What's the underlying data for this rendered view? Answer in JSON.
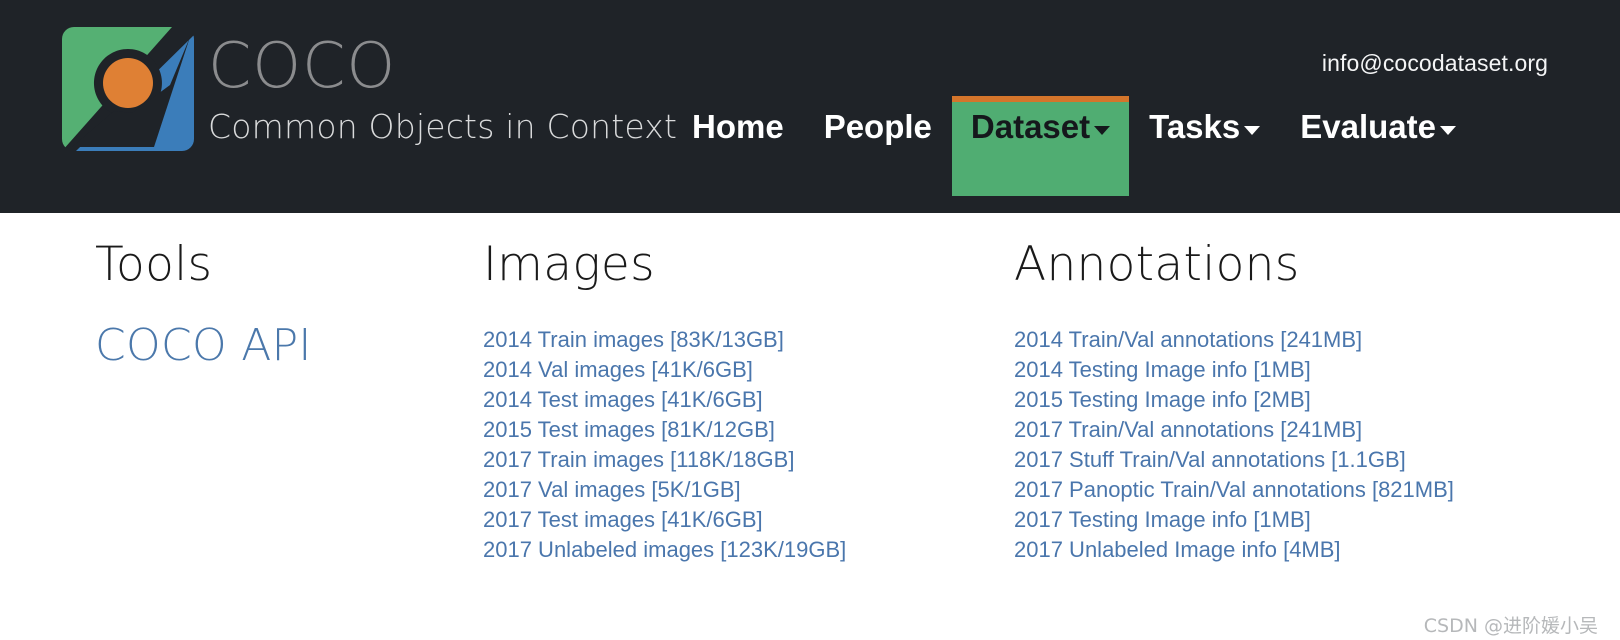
{
  "header": {
    "brand": {
      "title": "COCO",
      "subtitle": "Common Objects in Context",
      "logo_icon": "coco-logo-icon",
      "colors": {
        "green": "#55b073",
        "blue": "#3b7dba",
        "orange": "#df8034",
        "dark": "#1f2328"
      }
    },
    "contact_email": "info@cocodataset.org",
    "nav": [
      {
        "label": "Home",
        "has_caret": false,
        "active": false
      },
      {
        "label": "People",
        "has_caret": false,
        "active": false
      },
      {
        "label": "Dataset",
        "has_caret": true,
        "active": true
      },
      {
        "label": "Tasks",
        "has_caret": true,
        "active": false
      },
      {
        "label": "Evaluate",
        "has_caret": true,
        "active": false
      }
    ],
    "active_tab_bg": "#50ad72",
    "active_tab_border": "#d4752b",
    "background": "#1f2328"
  },
  "main": {
    "link_color": "#4a76ac",
    "columns": {
      "tools": {
        "heading": "Tools",
        "links": [
          {
            "label": "COCO API"
          }
        ]
      },
      "images": {
        "heading": "Images",
        "links": [
          {
            "label": "2014 Train images [83K/13GB]"
          },
          {
            "label": "2014 Val images [41K/6GB]"
          },
          {
            "label": "2014 Test images [41K/6GB]"
          },
          {
            "label": "2015 Test images [81K/12GB]"
          },
          {
            "label": "2017 Train images [118K/18GB]"
          },
          {
            "label": "2017 Val images [5K/1GB]"
          },
          {
            "label": "2017 Test images [41K/6GB]"
          },
          {
            "label": "2017 Unlabeled images [123K/19GB]"
          }
        ]
      },
      "annotations": {
        "heading": "Annotations",
        "links": [
          {
            "label": "2014 Train/Val annotations [241MB]"
          },
          {
            "label": "2014 Testing Image info [1MB]"
          },
          {
            "label": "2015 Testing Image info [2MB]"
          },
          {
            "label": "2017 Train/Val annotations [241MB]"
          },
          {
            "label": "2017 Stuff Train/Val annotations [1.1GB]"
          },
          {
            "label": "2017 Panoptic Train/Val annotations [821MB]"
          },
          {
            "label": "2017 Testing Image info [1MB]"
          },
          {
            "label": "2017 Unlabeled Image info [4MB]"
          }
        ]
      }
    }
  },
  "watermark": {
    "text": "CSDN @进阶媛小吴"
  }
}
